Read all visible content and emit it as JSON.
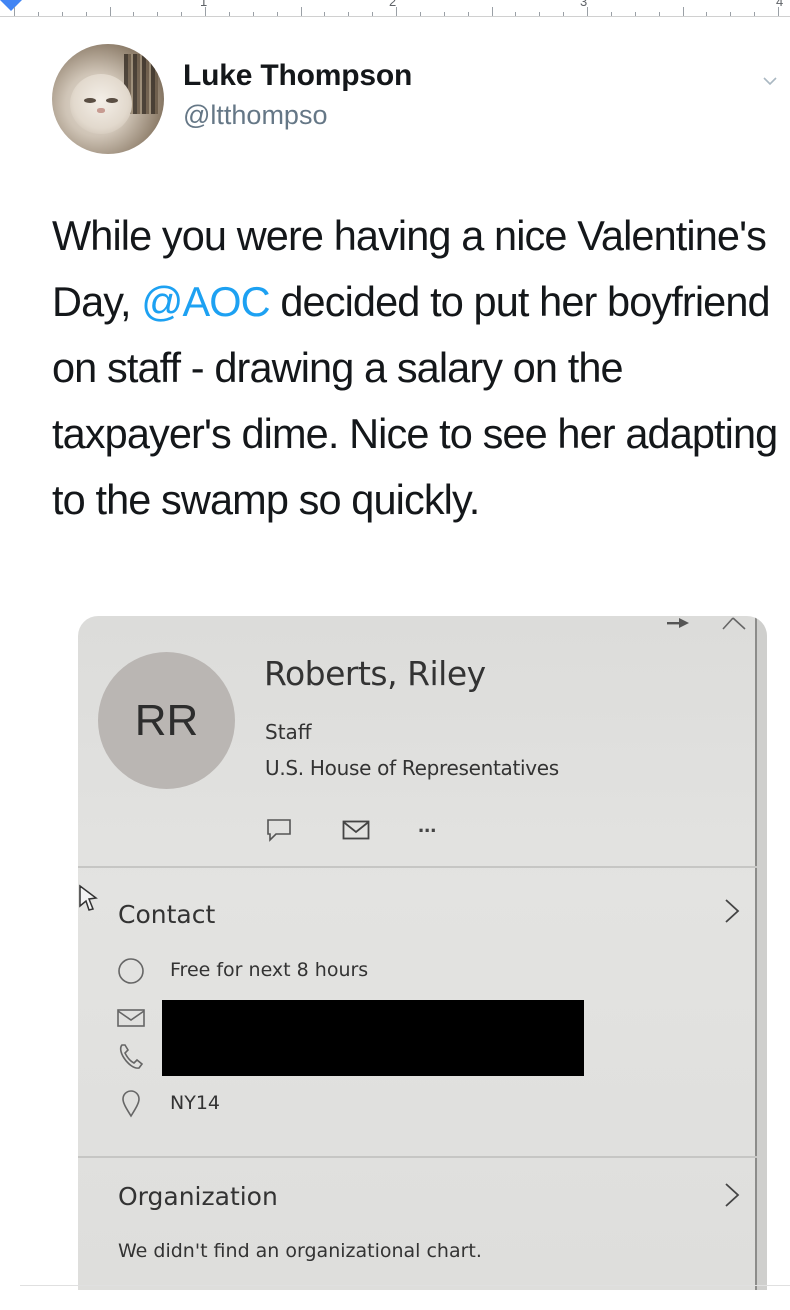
{
  "ruler": {
    "numbers": [
      "1",
      "2",
      "3",
      "4"
    ]
  },
  "tweet": {
    "display_name": "Luke Thompson",
    "handle": "@ltthompso",
    "text_before": "While you were having a nice Valentine's Day, ",
    "mention": "@AOC",
    "text_after": " decided to put her boyfriend on staff - drawing a salary on the taxpayer's dime. Nice to see her adapting to the swamp so quickly.",
    "colors": {
      "text": "#14171a",
      "handle": "#657786",
      "mention": "#1da1f2"
    }
  },
  "contact_card": {
    "initials": "RR",
    "name": "Roberts, Riley",
    "title": "Staff",
    "organization": "U.S. House of Representatives",
    "actions": [
      "chat-icon",
      "mail-icon",
      "more-icon"
    ],
    "more_label": "...",
    "contact_section": {
      "title": "Contact",
      "availability": "Free for next 8 hours",
      "location": "NY14"
    },
    "organization_section": {
      "title": "Organization",
      "message": "We didn't find an organizational chart."
    }
  }
}
